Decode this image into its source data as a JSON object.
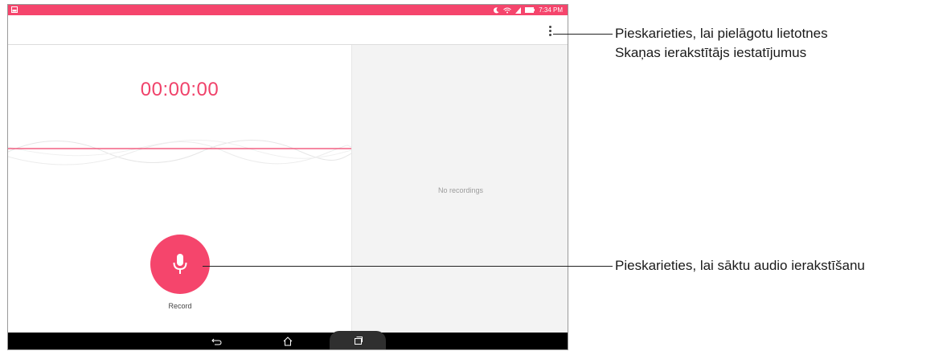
{
  "status_bar": {
    "time": "7:34 PM",
    "icons": [
      "notification-icon",
      "moon-icon",
      "wifi-icon",
      "signal-icon",
      "battery-icon"
    ],
    "color": "#f5456c"
  },
  "app_bar": {
    "menu_icon": "more-vertical-icon"
  },
  "recorder": {
    "timer": "00:00:00",
    "record_label": "Record",
    "mic_icon": "microphone-icon",
    "accent_color": "#f5456c"
  },
  "recordings": {
    "empty_text": "No recordings"
  },
  "nav_bar": {
    "back_icon": "back-icon",
    "home_icon": "home-icon",
    "recents_icon": "recents-icon"
  },
  "callouts": {
    "settings_line1": "Pieskarieties, lai pielāgotu lietotnes",
    "settings_line2": "Skaņas ierakstītājs iestatījumus",
    "record": "Pieskarieties, lai sāktu audio ierakstīšanu"
  }
}
